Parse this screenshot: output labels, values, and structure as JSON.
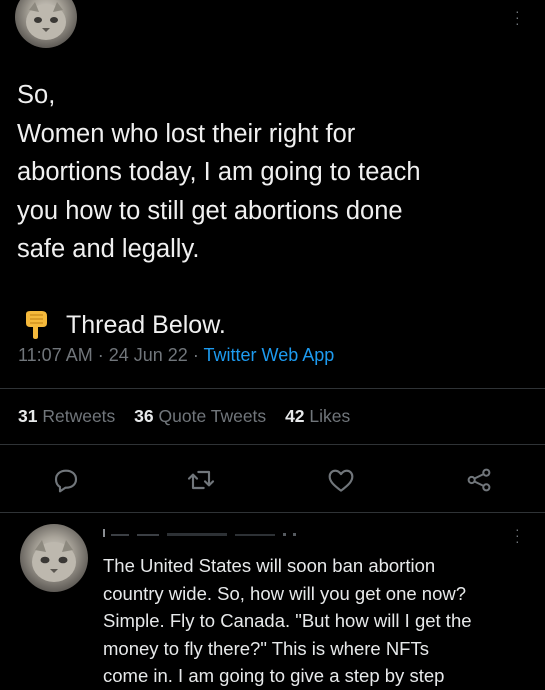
{
  "tweet": {
    "text_lines": [
      "So,",
      "Women who lost their right for",
      "abortions today, I am going to teach",
      "you how to still get abortions done",
      "safe and legally."
    ],
    "thread_label": "Thread Below.",
    "time": "11:07 AM",
    "date": "24 Jun 22",
    "source": "Twitter Web App",
    "sep": "·"
  },
  "stats": {
    "retweets_count": "31",
    "retweets_label": "Retweets",
    "quotes_count": "36",
    "quotes_label": "Quote Tweets",
    "likes_count": "42",
    "likes_label": "Likes"
  },
  "icons": {
    "thread": "pointing-down-hand-icon",
    "reply": "reply-icon",
    "retweet": "retweet-icon",
    "like": "heart-icon",
    "share": "share-icon"
  },
  "reply": {
    "text_lines": [
      "The United States will soon ban abortion",
      "country wide. So, how will you get one now?",
      "Simple. Fly to Canada. \"But how will I get the",
      "money to fly there?\" This is where NFTs",
      "come in. I am going to give a step by step"
    ]
  },
  "colors": {
    "background": "#000000",
    "text": "#e7e9ea",
    "secondary": "#71767b",
    "link": "#1d9bf0"
  }
}
